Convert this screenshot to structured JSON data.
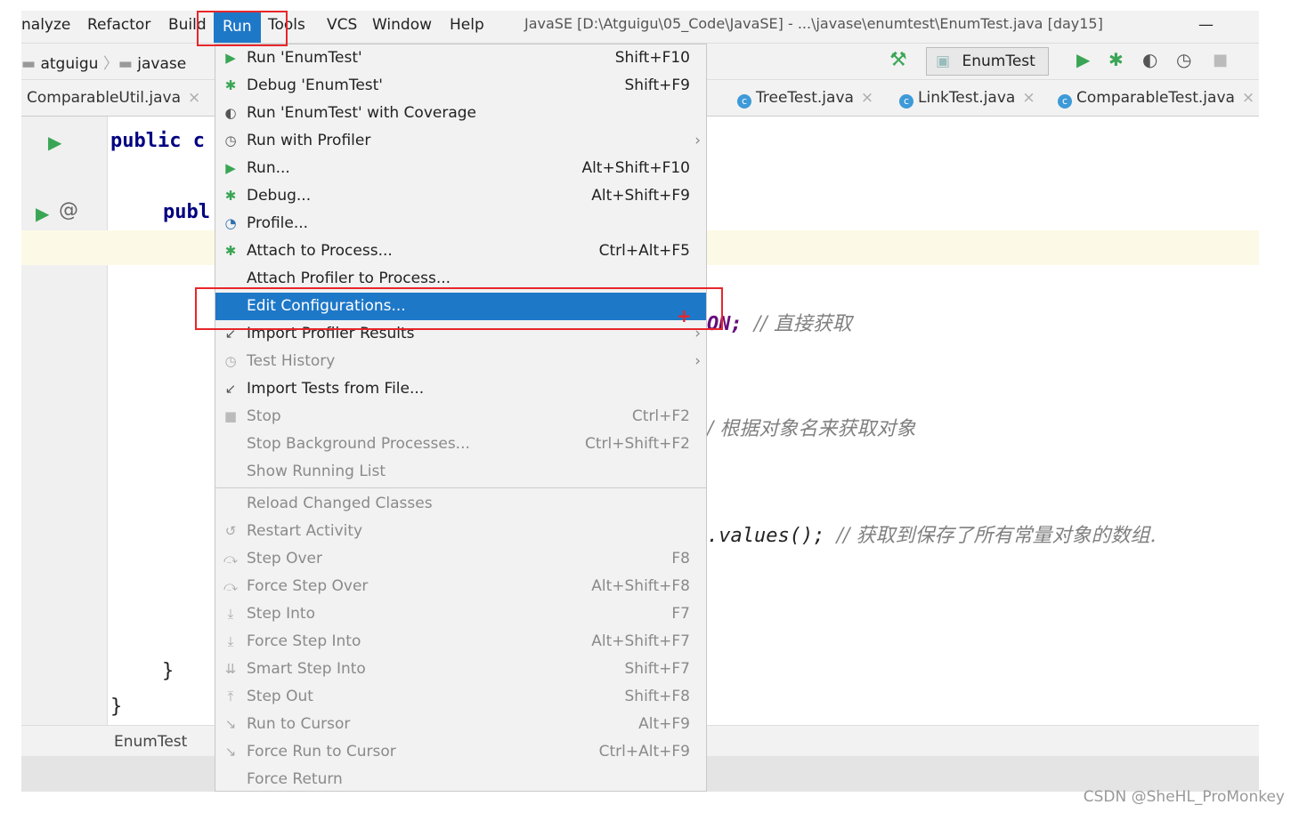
{
  "menubar": {
    "items": [
      "nalyze",
      "Refactor",
      "Build",
      "Run",
      "Tools",
      "VCS",
      "Window",
      "Help"
    ],
    "selected": "Run",
    "title": "JavaSE [D:\\Atguigu\\05_Code\\JavaSE] - ...\\javase\\enumtest\\EnumTest.java [day15]",
    "minimize": "—"
  },
  "toolbar": {
    "breadcrumb": [
      "atguigu",
      "javase"
    ],
    "run_config": "EnumTest"
  },
  "tabs": [
    "ComparableUtil.java",
    "TreeTest.java",
    "LinkTest.java",
    "ComparableTest.java"
  ],
  "code": {
    "line1": "public c",
    "line2": "publ",
    "line3_suffix": "ON;",
    "line3_comment": "// 直接获取",
    "line4_comment": "/ 根据对象名来获取对象",
    "line5_code": ".values();",
    "line5_comment": "// 获取到保存了所有常量对象的数组.",
    "brace1": "}",
    "brace2": "}"
  },
  "crumb": "EnumTest",
  "menu": {
    "items": [
      {
        "label": "Run 'EnumTest'",
        "shortcut": "Shift+F10",
        "icon": "run-icon"
      },
      {
        "label": "Debug 'EnumTest'",
        "shortcut": "Shift+F9",
        "icon": "debug-icon"
      },
      {
        "label": "Run 'EnumTest' with Coverage",
        "shortcut": "",
        "icon": "coverage-icon"
      },
      {
        "label": "Run with Profiler",
        "shortcut": "",
        "icon": "profiler-icon",
        "submenu": true
      },
      {
        "label": "Run...",
        "shortcut": "Alt+Shift+F10",
        "icon": "run-icon"
      },
      {
        "label": "Debug...",
        "shortcut": "Alt+Shift+F9",
        "icon": "debug-icon"
      },
      {
        "label": "Profile...",
        "shortcut": "",
        "icon": "profile-icon"
      },
      {
        "label": "Attach to Process...",
        "shortcut": "Ctrl+Alt+F5",
        "icon": "attach-icon"
      },
      {
        "label": "Attach Profiler to Process...",
        "shortcut": "",
        "icon": ""
      },
      {
        "label": "Edit Configurations...",
        "shortcut": "",
        "icon": "",
        "selected": true
      },
      {
        "label": "Import Profiler Results",
        "shortcut": "",
        "icon": "import-icon",
        "submenu": true
      },
      {
        "label": "Test History",
        "shortcut": "",
        "icon": "history-icon",
        "submenu": true,
        "disabled": true
      },
      {
        "label": "Import Tests from File...",
        "shortcut": "",
        "icon": "import-icon"
      },
      {
        "label": "Stop",
        "shortcut": "Ctrl+F2",
        "icon": "stop-icon",
        "disabled": true
      },
      {
        "label": "Stop Background Processes...",
        "shortcut": "Ctrl+Shift+F2",
        "icon": "",
        "disabled": true
      },
      {
        "label": "Show Running List",
        "shortcut": "",
        "icon": "",
        "disabled": true
      },
      {
        "label": "Reload Changed Classes",
        "shortcut": "",
        "icon": "",
        "disabled": true,
        "sep_before": true
      },
      {
        "label": "Restart Activity",
        "shortcut": "",
        "icon": "restart-icon",
        "disabled": true
      },
      {
        "label": "Step Over",
        "shortcut": "F8",
        "icon": "step-over-icon",
        "disabled": true
      },
      {
        "label": "Force Step Over",
        "shortcut": "Alt+Shift+F8",
        "icon": "step-over-icon",
        "disabled": true
      },
      {
        "label": "Step Into",
        "shortcut": "F7",
        "icon": "step-into-icon",
        "disabled": true
      },
      {
        "label": "Force Step Into",
        "shortcut": "Alt+Shift+F7",
        "icon": "step-into-icon",
        "disabled": true
      },
      {
        "label": "Smart Step Into",
        "shortcut": "Shift+F7",
        "icon": "smart-step-icon",
        "disabled": true
      },
      {
        "label": "Step Out",
        "shortcut": "Shift+F8",
        "icon": "step-out-icon",
        "disabled": true
      },
      {
        "label": "Run to Cursor",
        "shortcut": "Alt+F9",
        "icon": "run-cursor-icon",
        "disabled": true
      },
      {
        "label": "Force Run to Cursor",
        "shortcut": "Ctrl+Alt+F9",
        "icon": "run-cursor-icon",
        "disabled": true
      },
      {
        "label": "Force Return",
        "shortcut": "",
        "icon": "",
        "disabled": true
      }
    ]
  },
  "watermark": "CSDN @SheHL_ProMonkey",
  "colors": {
    "accent": "#1e78c8",
    "highlight_box": "#e8262b",
    "run_green": "#3aa655"
  }
}
